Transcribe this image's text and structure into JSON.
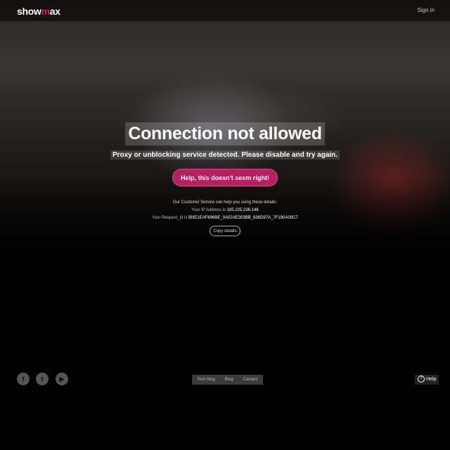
{
  "header": {
    "logo_left": "show",
    "logo_dot": "m",
    "logo_right": "ax",
    "signin_label": "Sign in"
  },
  "main": {
    "title": "Connection not allowed",
    "subtitle": "Proxy or unblocking service detected. Please disable and try again.",
    "help_button_label": "Help, this doesn't seem right!",
    "details_intro": "Our Customer Service can help you using these details:",
    "ip_label": "Your IP Address is",
    "ip_value": "185.225.236.146",
    "request_label": "Your Request_id is",
    "request_value": "BNE1EAF696BE_0A02AE303BB_638D97A_7F190A00C7",
    "copy_button_label": "Copy details"
  },
  "footer": {
    "social": [
      {
        "name": "facebook",
        "glyph": "f"
      },
      {
        "name": "twitter",
        "glyph": "t"
      },
      {
        "name": "youtube",
        "glyph": "▶"
      }
    ],
    "links": [
      "Tech blog",
      "Blog",
      "Careers"
    ],
    "help_label": "Help",
    "help_glyph": "?"
  },
  "colors": {
    "brand": "#c0266b",
    "help_button": "#b52060",
    "background": "#000000"
  }
}
